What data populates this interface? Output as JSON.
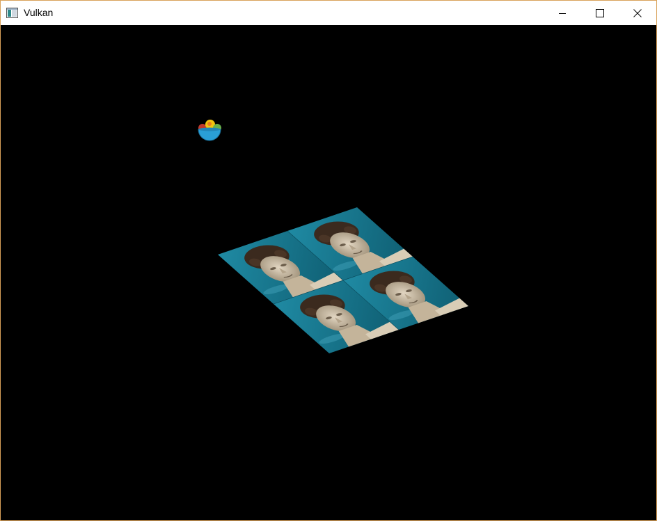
{
  "window": {
    "title": "Vulkan",
    "minimize_label": "",
    "maximize_label": "",
    "close_label": ""
  },
  "scene": {
    "background_color": "#000000",
    "textured_plane": {
      "tile_count": 4,
      "texture_subject": "statue-head-on-teal-sky"
    },
    "ball_object": {
      "icon": "fruit-bowl-sprite"
    }
  },
  "colors": {
    "titlebar_bg": "#ffffff",
    "window_border": "#d9a15a",
    "teal_sky": "#1b7f96",
    "stone": "#c9b9a0"
  }
}
